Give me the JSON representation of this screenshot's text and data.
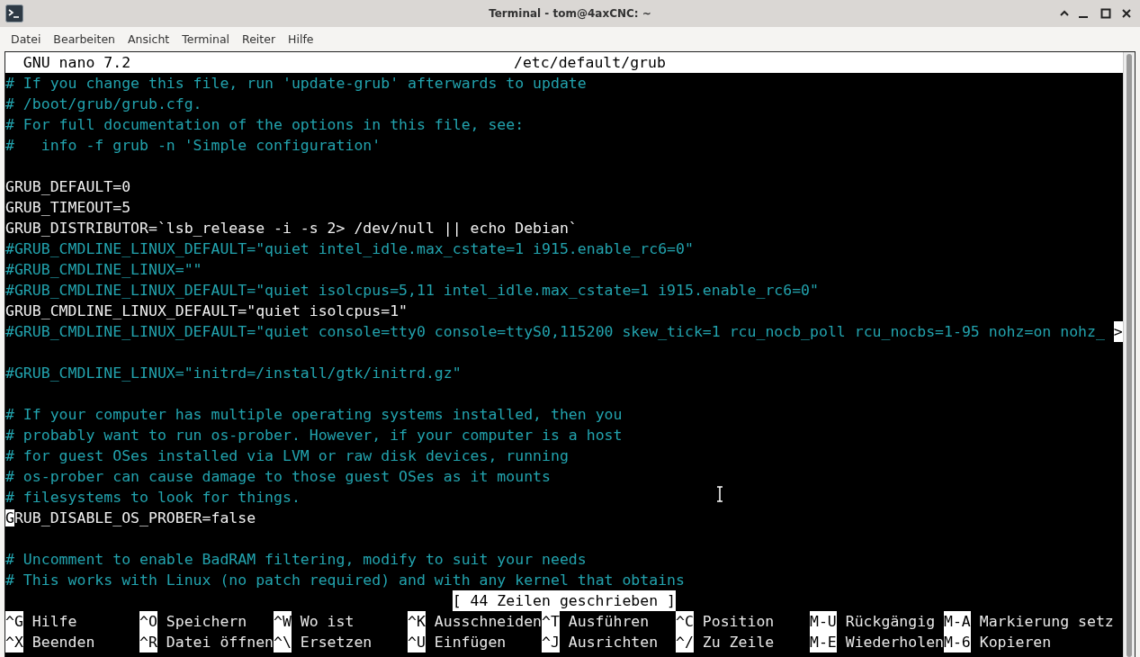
{
  "window": {
    "title": "Terminal - tom@4axCNC: ~"
  },
  "menu": [
    "Datei",
    "Bearbeiten",
    "Ansicht",
    "Terminal",
    "Reiter",
    "Hilfe"
  ],
  "nano": {
    "version": "GNU nano 7.2",
    "filename": "/etc/default/grub"
  },
  "lines": [
    {
      "kind": "comment",
      "text": "# If you change this file, run 'update-grub' afterwards to update"
    },
    {
      "kind": "comment",
      "text": "# /boot/grub/grub.cfg."
    },
    {
      "kind": "comment",
      "text": "# For full documentation of the options in this file, see:"
    },
    {
      "kind": "comment",
      "text": "#   info -f grub -n 'Simple configuration'"
    },
    {
      "kind": "blank"
    },
    {
      "kind": "code",
      "text": "GRUB_DEFAULT=0"
    },
    {
      "kind": "code",
      "text": "GRUB_TIMEOUT=5"
    },
    {
      "kind": "code",
      "text": "GRUB_DISTRIBUTOR=`lsb_release -i -s 2> /dev/null || echo Debian`"
    },
    {
      "kind": "comment",
      "text": "#GRUB_CMDLINE_LINUX_DEFAULT=\"quiet intel_idle.max_cstate=1 i915.enable_rc6=0\""
    },
    {
      "kind": "comment",
      "text": "#GRUB_CMDLINE_LINUX=\"\""
    },
    {
      "kind": "comment",
      "text": "#GRUB_CMDLINE_LINUX_DEFAULT=\"quiet isolcpus=5,11 intel_idle.max_cstate=1 i915.enable_rc6=0\""
    },
    {
      "kind": "code",
      "text": "GRUB_CMDLINE_LINUX_DEFAULT=\"quiet isolcpus=1\""
    },
    {
      "kind": "comment",
      "text": "#GRUB_CMDLINE_LINUX_DEFAULT=\"quiet console=tty0 console=ttyS0,115200 skew_tick=1 rcu_nocb_poll rcu_nocbs=1-95 nohz=on nohz_",
      "overflow_marker": ">"
    },
    {
      "kind": "blank"
    },
    {
      "kind": "comment",
      "text": "#GRUB_CMDLINE_LINUX=\"initrd=/install/gtk/initrd.gz\""
    },
    {
      "kind": "blank"
    },
    {
      "kind": "comment",
      "text": "# If your computer has multiple operating systems installed, then you"
    },
    {
      "kind": "comment",
      "text": "# probably want to run os-prober. However, if your computer is a host"
    },
    {
      "kind": "comment",
      "text": "# for guest OSes installed via LVM or raw disk devices, running"
    },
    {
      "kind": "comment",
      "text": "# os-prober can cause damage to those guest OSes as it mounts"
    },
    {
      "kind": "comment",
      "text": "# filesystems to look for things."
    },
    {
      "kind": "code",
      "text": "GRUB_DISABLE_OS_PROBER=false",
      "cursor": true
    },
    {
      "kind": "blank"
    },
    {
      "kind": "comment",
      "text": "# Uncomment to enable BadRAM filtering, modify to suit your needs"
    },
    {
      "kind": "comment",
      "text": "# This works with Linux (no patch required) and with any kernel that obtains"
    }
  ],
  "status": "[ 44 Zeilen geschrieben ]",
  "shortcuts": [
    [
      {
        "key": "^G",
        "label": "Hilfe"
      },
      {
        "key": "^O",
        "label": "Speichern"
      },
      {
        "key": "^W",
        "label": "Wo ist"
      },
      {
        "key": "^K",
        "label": "Ausschneiden"
      },
      {
        "key": "^T",
        "label": "Ausführen"
      },
      {
        "key": "^C",
        "label": "Position"
      },
      {
        "key": "M-U",
        "label": "Rückgängig"
      },
      {
        "key": "M-A",
        "label": "Markierung setz"
      }
    ],
    [
      {
        "key": "^X",
        "label": "Beenden"
      },
      {
        "key": "^R",
        "label": "Datei öffnen"
      },
      {
        "key": "^\\",
        "label": "Ersetzen"
      },
      {
        "key": "^U",
        "label": "Einfügen"
      },
      {
        "key": "^J",
        "label": "Ausrichten"
      },
      {
        "key": "^/",
        "label": "Zu Zeile"
      },
      {
        "key": "M-E",
        "label": "Wiederholen"
      },
      {
        "key": "M-6",
        "label": "Kopieren"
      }
    ]
  ]
}
